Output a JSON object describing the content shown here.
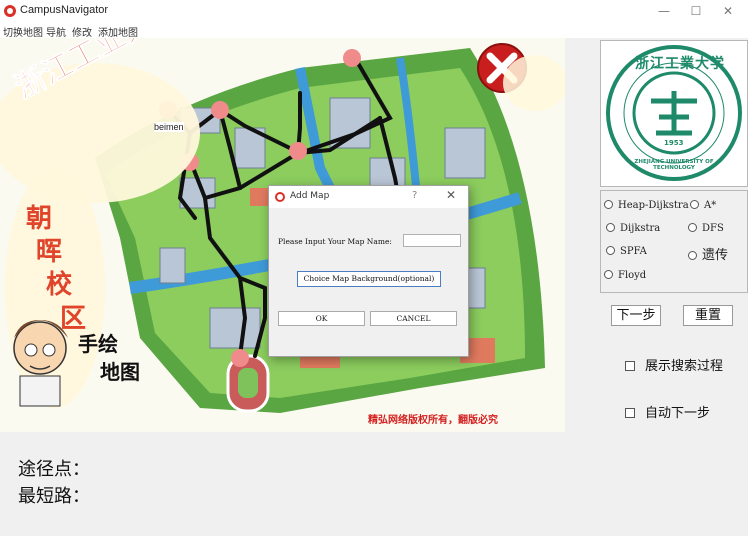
{
  "window": {
    "title": "CampusNavigator",
    "min": "—",
    "max": "☐",
    "close": "✕"
  },
  "menu": [
    "切换地图",
    "导航",
    "修改",
    "添加地图"
  ],
  "map": {
    "school_name": "浙江工业大学",
    "campus_chars": [
      "朝",
      "晖",
      "校",
      "区"
    ],
    "hand_drawn": "手绘",
    "map_word": "地图",
    "node_label": "beimen",
    "copyright": "精弘网络版权所有，翻版必究"
  },
  "logo": {
    "top_text": "浙江工業大学",
    "bottom_text": "ZHEJIANG UNIVERSITY OF TECHNOLOGY",
    "year": "1953"
  },
  "algorithms": [
    {
      "label": "Heap-Dijkstra"
    },
    {
      "label": "A*"
    },
    {
      "label": "Dijkstra"
    },
    {
      "label": "DFS"
    },
    {
      "label": "SPFA"
    },
    {
      "label": "遗传"
    },
    {
      "label": "Floyd"
    }
  ],
  "buttons": {
    "next": "下一步",
    "reset": "重置"
  },
  "checkboxes": {
    "show_process": "展示搜索过程",
    "auto_next": "自动下一步"
  },
  "bottom": {
    "waypoints": "途径点：",
    "shortest": "最短路："
  },
  "dialog": {
    "title": "Add Map",
    "help": "?",
    "close": "✕",
    "prompt": "Please Input Your Map Name:",
    "name_value": "",
    "choose_bg": "Choice Map Background(optional)",
    "ok": "OK",
    "cancel": "CANCEL"
  }
}
